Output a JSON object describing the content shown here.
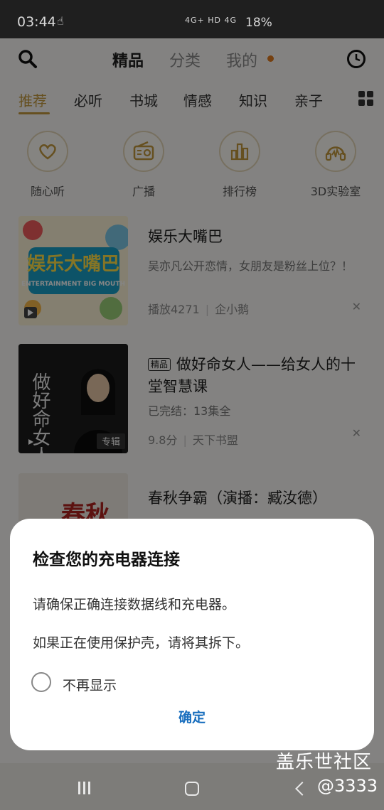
{
  "status_bar": {
    "time": "03:44",
    "network": "4G+ HD 4G",
    "battery": "18%"
  },
  "top_nav": {
    "tabs": [
      "精品",
      "分类",
      "我的"
    ],
    "active_index": 0
  },
  "categories": {
    "items": [
      "推荐",
      "必听",
      "书城",
      "情感",
      "知识",
      "亲子"
    ],
    "active_index": 0
  },
  "quick_entries": [
    {
      "label": "随心听",
      "icon": "heart-icon"
    },
    {
      "label": "广播",
      "icon": "radio-icon"
    },
    {
      "label": "排行榜",
      "icon": "chart-icon"
    },
    {
      "label": "3D实验室",
      "icon": "headphones-icon"
    }
  ],
  "list": [
    {
      "title": "娱乐大嘴巴",
      "desc": "吴亦凡公开恋情，女朋友是粉丝上位？！",
      "meta_left": "播放4271",
      "meta_right": "企小鹅",
      "cover_text": "娱乐大嘴巴",
      "cover_sub": "ENTERTAINMENT BIG MOUTH"
    },
    {
      "badge": "精品",
      "title": "做好命女人——给女人的十堂智慧课",
      "desc": "已完结：13集全",
      "meta_left": "9.8分",
      "meta_right": "天下书盟",
      "cover_text": "做好命女人",
      "cover_tag": "专辑"
    },
    {
      "title": "春秋争霸（演播：臧汝德）",
      "cover_text": "春秋"
    }
  ],
  "dialog": {
    "title": "检查您的充电器连接",
    "line1": "请确保正确连接数据线和充电器。",
    "line2": "如果正在使用保护壳，请将其拆下。",
    "checkbox_label": "不再显示",
    "confirm": "确定"
  },
  "watermark": {
    "line1": "盖乐世社区",
    "line2": "@3333"
  },
  "colors": {
    "accent": "#c49a3f",
    "dialog_button": "#1a6fbe",
    "dot": "#e07b20"
  }
}
